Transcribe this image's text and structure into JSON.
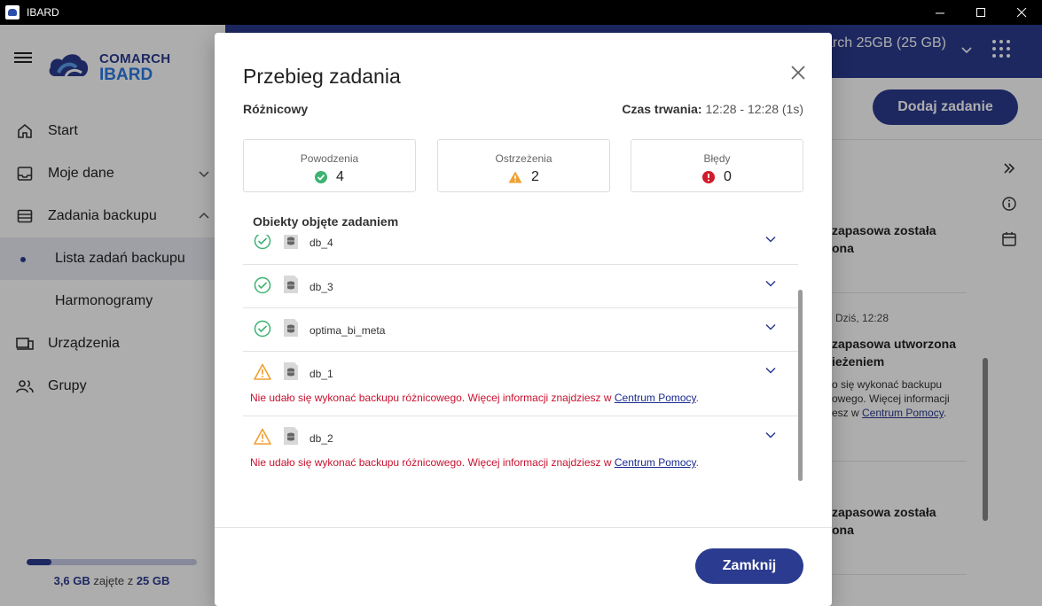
{
  "window": {
    "title": "IBARD"
  },
  "logo": {
    "line1": "COMARCH",
    "line2": "IBARD"
  },
  "sidebar": {
    "items": [
      {
        "label": "Start",
        "icon": "home-icon"
      },
      {
        "label": "Moje dane",
        "icon": "inbox-icon"
      },
      {
        "label": "Zadania backupu",
        "icon": "list-icon"
      },
      {
        "label": "Lista zadań backupu"
      },
      {
        "label": "Harmonogramy"
      },
      {
        "label": "Urządzenia",
        "icon": "devices-icon"
      },
      {
        "label": "Grupy",
        "icon": "group-icon"
      }
    ],
    "storage": {
      "used": "3,6 GB",
      "mid": " zajęte z ",
      "total": "25 GB",
      "fraction": 0.144
    }
  },
  "topbar": {
    "plan": "arch 25GB (25 GB)"
  },
  "header": {
    "add_task": "Dodaj zadanie"
  },
  "right_panel": {
    "items": [
      {
        "heading": "zapasowa została\nona"
      },
      {
        "date": "Dziś, 12:28",
        "heading": "zapasowa utworzona\nieżeniem",
        "text1": "o się wykonać backupu\nowego. Więcej informacji\nesz w ",
        "link": "Centrum Pomocy",
        "text2": "."
      },
      {
        "heading": "zapasowa została\nona"
      }
    ]
  },
  "modal": {
    "title": "Przebieg zadania",
    "type": "Różnicowy",
    "duration_label": "Czas trwania:",
    "duration_value": " 12:28 - 12:28 (1s)",
    "stats": [
      {
        "label": "Powodzenia",
        "value": "4",
        "status": "success",
        "color": "#3cb371"
      },
      {
        "label": "Ostrzeżenia",
        "value": "2",
        "status": "warning",
        "color": "#f0a030"
      },
      {
        "label": "Błędy",
        "value": "0",
        "status": "error",
        "color": "#d01c2c"
      }
    ],
    "objects_title": "Obiekty objęte zadaniem",
    "objects": [
      {
        "name": "db_4",
        "status": "success"
      },
      {
        "name": "db_3",
        "status": "success"
      },
      {
        "name": "optima_bi_meta",
        "status": "success"
      },
      {
        "name": "db_1",
        "status": "warning",
        "error": "Nie udało się wykonać backupu różnicowego. Więcej informacji znajdziesz w ",
        "link": "Centrum Pomocy",
        "error_end": "."
      },
      {
        "name": "db_2",
        "status": "warning",
        "error": "Nie udało się wykonać backupu różnicowego. Więcej informacji znajdziesz w ",
        "link": "Centrum Pomocy",
        "error_end": "."
      }
    ],
    "close_button": "Zamknij"
  }
}
